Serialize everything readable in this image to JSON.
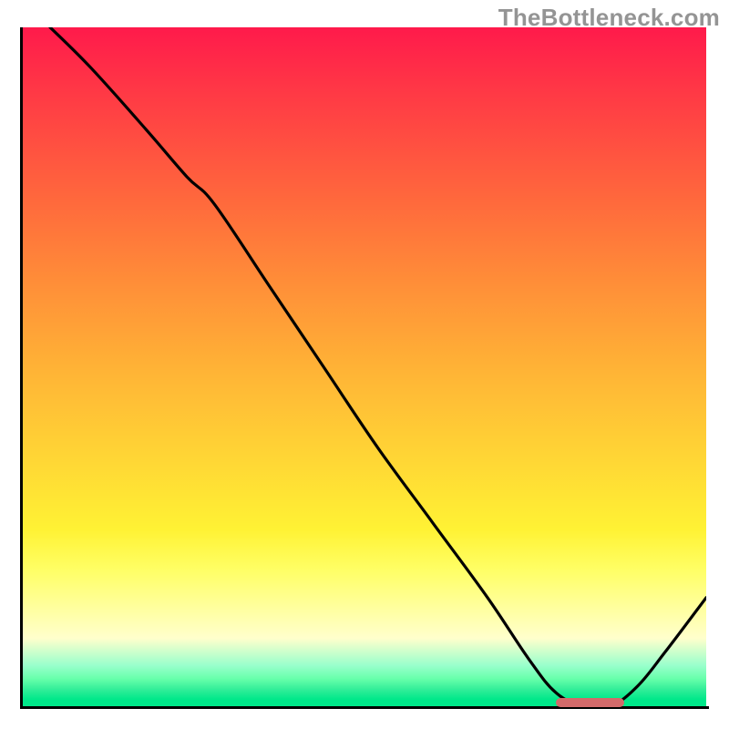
{
  "watermark": "TheBottleneck.com",
  "colors": {
    "curve_stroke": "#000000",
    "marker_fill": "#d36a6a"
  },
  "chart_data": {
    "type": "line",
    "title": "",
    "xlabel": "",
    "ylabel": "",
    "xlim": [
      0,
      100
    ],
    "ylim": [
      0,
      100
    ],
    "grid": false,
    "legend": false,
    "description": "A single black curve plotted on a vertical red→orange→yellow→pale-yellow→green gradient (green at the very bottom). The curve starts at the top-left corner (≈x=4, y≈100), descends with a slight initial bow, reaches a knee around x≈28 y≈75, continues almost linearly down to a minimum of y≈0 near x≈80–85, then rises again to y≈16 at x≈100. A short rounded pink/red marker sits on the x-axis at the curve's minimum (roughly x 78–88).",
    "series": [
      {
        "name": "curve",
        "x": [
          4,
          10,
          18,
          24,
          28,
          36,
          44,
          52,
          60,
          68,
          74,
          78,
          82,
          86,
          90,
          94,
          100
        ],
        "y": [
          100,
          94,
          85,
          78,
          74,
          62,
          50,
          38,
          27,
          16,
          7,
          2,
          0,
          0,
          3,
          8,
          16
        ]
      }
    ],
    "marker": {
      "x_start": 78,
      "x_end": 88,
      "y": 0
    },
    "gradient_stops": [
      {
        "pos": 0.0,
        "color": "#ff1a4b"
      },
      {
        "pos": 0.26,
        "color": "#ff6a3c"
      },
      {
        "pos": 0.5,
        "color": "#ffb236"
      },
      {
        "pos": 0.74,
        "color": "#fff234"
      },
      {
        "pos": 0.9,
        "color": "#ffffcc"
      },
      {
        "pos": 0.96,
        "color": "#66ffaa"
      },
      {
        "pos": 1.0,
        "color": "#00e88a"
      }
    ]
  }
}
